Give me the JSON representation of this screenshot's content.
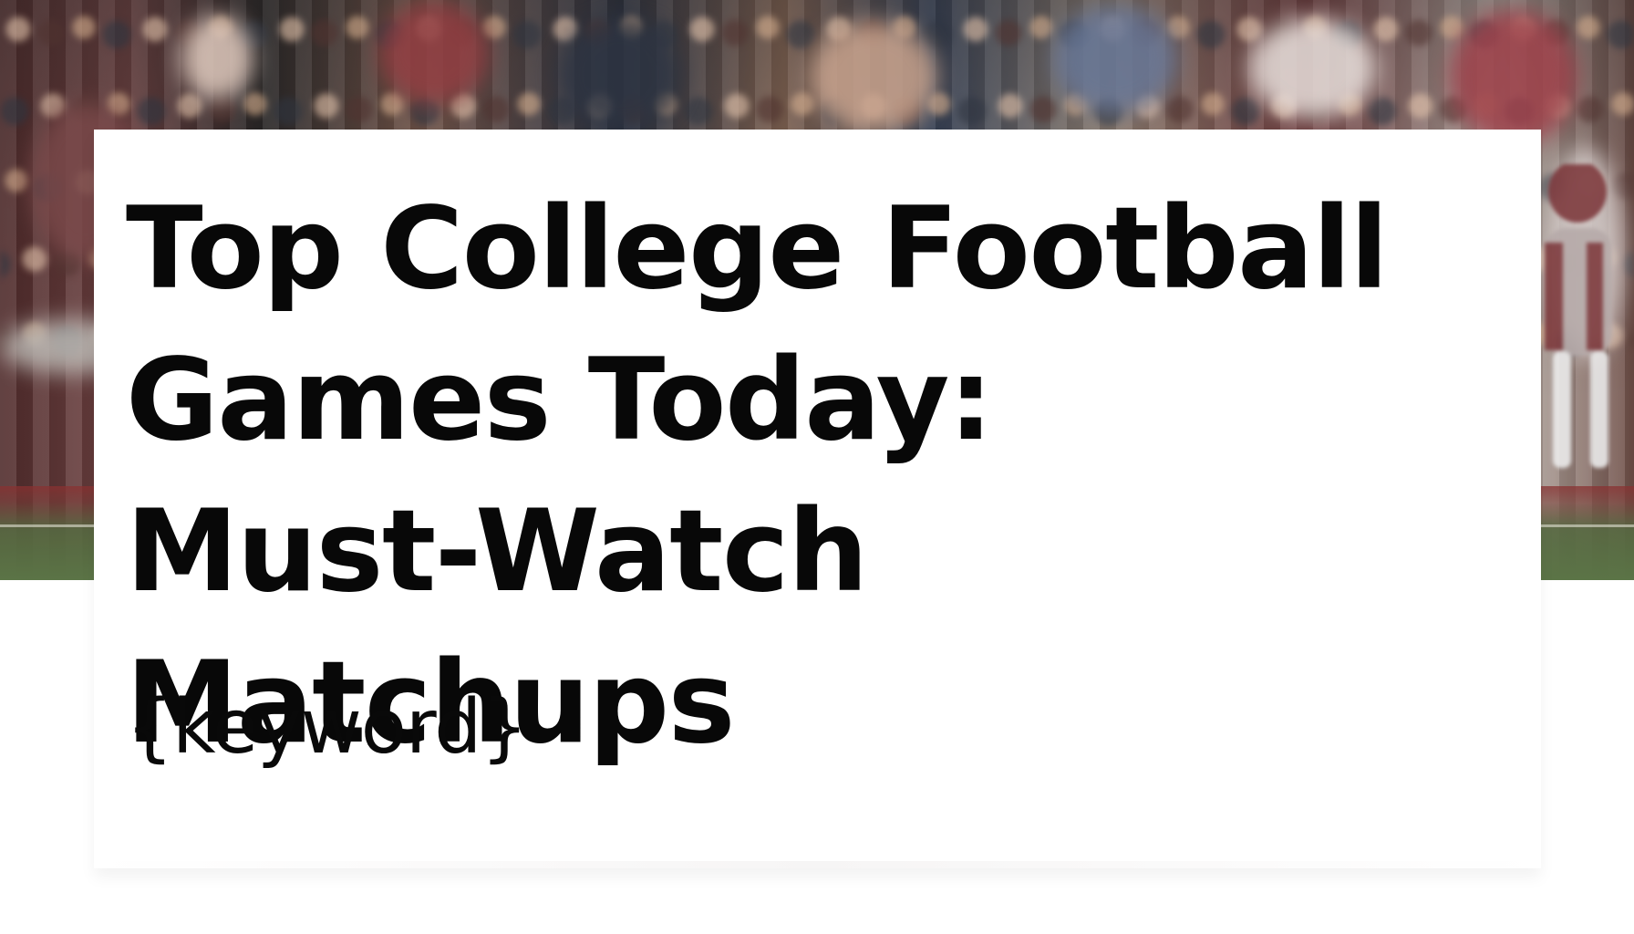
{
  "headline": {
    "title": "Top College Football\nGames Today:\nMust-Watch Matchups",
    "keyword": "{keyword}"
  },
  "visual": {
    "background": "blurred football stadium crowd",
    "card_color": "#ffffff",
    "text_color": "#080808",
    "field_color": "#5c7448",
    "crowd_accent": "#7b3a3d"
  }
}
